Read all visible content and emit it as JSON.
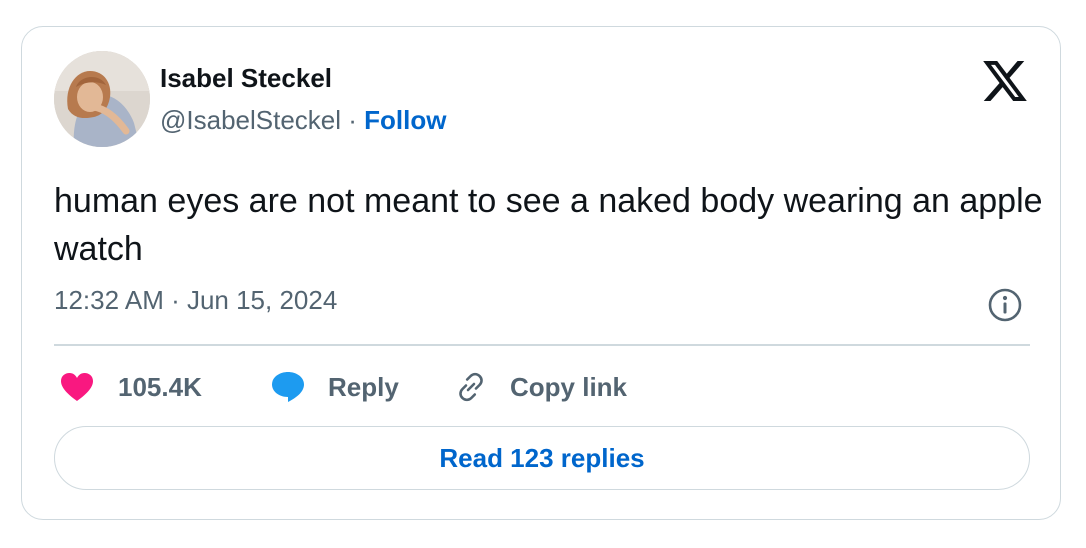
{
  "author": {
    "name": "Isabel Steckel",
    "handle": "@IsabelSteckel",
    "separator": " · ",
    "follow_label": "Follow"
  },
  "tweet": {
    "text": "human eyes are not meant to see a naked body wearing an apple watch",
    "timestamp": "12:32 AM · Jun 15, 2024"
  },
  "actions": {
    "likes_count": "105.4K",
    "reply_label": "Reply",
    "copy_link_label": "Copy link"
  },
  "read_replies_label": "Read 123 replies",
  "icons": {
    "logo": "x-logo-icon",
    "info": "info-icon",
    "like": "heart-icon",
    "reply": "speech-bubble-icon",
    "copy": "link-icon"
  },
  "colors": {
    "link_blue": "#0066cc",
    "heart": "#f91880",
    "reply_bubble": "#1d9bf0",
    "text_primary": "#0f1419",
    "text_secondary": "#536471",
    "border": "#cfd9de"
  }
}
